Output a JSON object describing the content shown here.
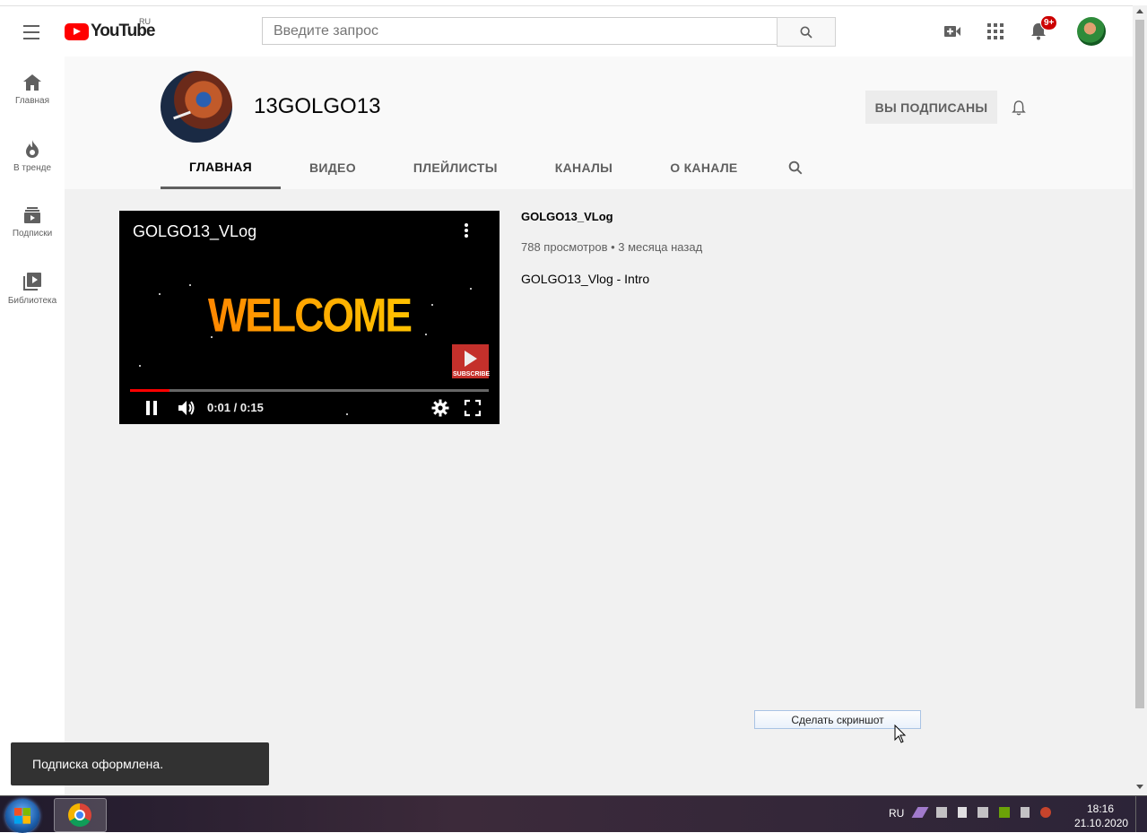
{
  "masthead": {
    "logo_text": "YouTube",
    "logo_region": "RU",
    "search_placeholder": "Введите запрос",
    "notifications_badge": "9+"
  },
  "guide": {
    "items": [
      {
        "label": "Главная",
        "icon": "home-icon"
      },
      {
        "label": "В тренде",
        "icon": "fire-icon"
      },
      {
        "label": "Подписки",
        "icon": "subscriptions-icon"
      },
      {
        "label": "Библиотека",
        "icon": "library-icon"
      }
    ]
  },
  "channel": {
    "name": "13GOLGO13",
    "subscribe_label": "ВЫ ПОДПИСАНЫ",
    "tabs": [
      "ГЛАВНАЯ",
      "ВИДЕО",
      "ПЛЕЙЛИСТЫ",
      "КАНАЛЫ",
      "О КАНАЛЕ"
    ],
    "active_tab": "ГЛАВНАЯ"
  },
  "player": {
    "title": "GOLGO13_VLog",
    "overlay_text": "WELCOME",
    "subscribe_text": "SUBSCRIBE",
    "time": "0:01 / 0:15",
    "progress_fraction": 0.11
  },
  "video": {
    "title": "GOLGO13_VLog",
    "meta": "788 просмотров • 3 месяца назад",
    "description": "GOLGO13_Vlog - Intro"
  },
  "screenshot_button": "Сделать скриншот",
  "toast": "Подписка оформлена.",
  "taskbar": {
    "lang": "RU",
    "time": "18:16",
    "date": "21.10.2020"
  },
  "colors": {
    "brand_red": "#ff0000",
    "content_bg": "#f1f1f1",
    "header_bg": "#f9f9f9"
  }
}
